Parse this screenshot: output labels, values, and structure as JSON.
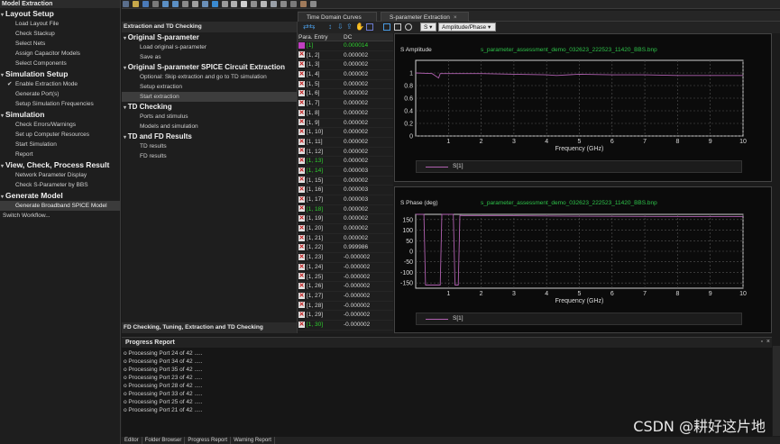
{
  "left_panel": {
    "title": "Model Extraction",
    "sections": [
      {
        "label": "Layout Setup",
        "items": [
          "Load Layout File",
          "Check Stackup",
          "Select Nets",
          "Assign Capacitor Models",
          "Select Components"
        ]
      },
      {
        "label": "Simulation Setup",
        "items": [
          "Enable Extraction Mode",
          "Generate Port(s)",
          "Setup Simulation Frequencies"
        ]
      },
      {
        "label": "Simulation",
        "items": [
          "Check Errors/Warnings",
          "Set up Computer Resources",
          "Start Simulation",
          "Report"
        ]
      },
      {
        "label": "View, Check, Process Result",
        "items": [
          "Network Parameter Display",
          "Check S-Parameter by BBS"
        ]
      },
      {
        "label": "Generate Model",
        "items": [
          "Generate Broadband SPICE Model"
        ]
      }
    ],
    "switch_workflow": "Switch Workflow..."
  },
  "mid_panel": {
    "header": "Extraction and TD Checking",
    "sections": [
      {
        "label": "Original S-parameter",
        "items": [
          "Load original s-parameter",
          "Save as"
        ]
      },
      {
        "label": "Original S-parameter SPICE Circuit Extraction",
        "items": [
          "Optional: Skip extraction and go to TD simulation",
          "Setup extraction",
          "Start extraction"
        ]
      },
      {
        "label": "TD Checking",
        "items": [
          "Ports and stimulus",
          "Models and simulation"
        ]
      },
      {
        "label": "TD and FD Results",
        "items": [
          "TD results",
          "FD results"
        ]
      }
    ],
    "footer": "FD Checking, Tuning, Extraction and TD Checking"
  },
  "table": {
    "headers": [
      "Para. Entry",
      "DC"
    ],
    "rows": [
      {
        "entry": "[1]",
        "dc": "0.000014",
        "green": true
      },
      {
        "entry": "[1, 2]",
        "dc": "0.000002",
        "green": false
      },
      {
        "entry": "[1, 3]",
        "dc": "0.000002",
        "green": false
      },
      {
        "entry": "[1, 4]",
        "dc": "0.000002",
        "green": false
      },
      {
        "entry": "[1, 5]",
        "dc": "0.000002",
        "green": false
      },
      {
        "entry": "[1, 6]",
        "dc": "0.000002",
        "green": false
      },
      {
        "entry": "[1, 7]",
        "dc": "0.000002",
        "green": false
      },
      {
        "entry": "[1, 8]",
        "dc": "0.000002",
        "green": false
      },
      {
        "entry": "[1, 9]",
        "dc": "0.000002",
        "green": false
      },
      {
        "entry": "[1, 10]",
        "dc": "0.000002",
        "green": false
      },
      {
        "entry": "[1, 11]",
        "dc": "0.000002",
        "green": false
      },
      {
        "entry": "[1, 12]",
        "dc": "0.000002",
        "green": false
      },
      {
        "entry": "[1, 13]",
        "dc": "0.000002",
        "green": true
      },
      {
        "entry": "[1, 14]",
        "dc": "0.000003",
        "green": true
      },
      {
        "entry": "[1, 15]",
        "dc": "0.000002",
        "green": false
      },
      {
        "entry": "[1, 16]",
        "dc": "0.000003",
        "green": false
      },
      {
        "entry": "[1, 17]",
        "dc": "0.000003",
        "green": false
      },
      {
        "entry": "[1, 18]",
        "dc": "0.000002",
        "green": true
      },
      {
        "entry": "[1, 19]",
        "dc": "0.000002",
        "green": false
      },
      {
        "entry": "[1, 20]",
        "dc": "0.000002",
        "green": false
      },
      {
        "entry": "[1, 21]",
        "dc": "0.000002",
        "green": false
      },
      {
        "entry": "[1, 22]",
        "dc": "0.999986",
        "green": false
      },
      {
        "entry": "[1, 23]",
        "dc": "-0.000002",
        "green": false
      },
      {
        "entry": "[1, 24]",
        "dc": "-0.000002",
        "green": false
      },
      {
        "entry": "[1, 25]",
        "dc": "-0.000002",
        "green": false
      },
      {
        "entry": "[1, 26]",
        "dc": "-0.000002",
        "green": false
      },
      {
        "entry": "[1, 27]",
        "dc": "-0.000002",
        "green": false
      },
      {
        "entry": "[1, 28]",
        "dc": "-0.000002",
        "green": false
      },
      {
        "entry": "[1, 29]",
        "dc": "-0.000002",
        "green": false
      },
      {
        "entry": "[1, 30]",
        "dc": "-0.000002",
        "green": true
      }
    ]
  },
  "tabs": [
    {
      "label": "Time Domain Curves",
      "active": false
    },
    {
      "label": "S-parameter Extraction",
      "active": true
    }
  ],
  "subtoolbar": {
    "param_select": "S",
    "view_select": "Amplitude/Phase"
  },
  "plots": {
    "amplitude": {
      "title": "S Amplitude",
      "file": "s_parameter_assessment_demo_032623_222523_11420_BBS.bnp",
      "legend": "S[1]"
    },
    "phase": {
      "title": "S Phase (deg)",
      "file": "s_parameter_assessment_demo_032623_222523_11420_BBS.bnp",
      "legend": "S[1]"
    }
  },
  "chart_data": [
    {
      "type": "line",
      "title": "S Amplitude",
      "xlabel": "Frequency (GHz)",
      "ylabel": "",
      "xlim": [
        0,
        10
      ],
      "ylim": [
        0,
        1.2
      ],
      "xticks": [
        1,
        2,
        3,
        4,
        5,
        6,
        7,
        8,
        9,
        10
      ],
      "yticks": [
        0,
        0.2,
        0.4,
        0.6,
        0.8,
        1
      ],
      "series": [
        {
          "name": "S[1]",
          "x": [
            0,
            0.5,
            0.7,
            0.75,
            1.3,
            2,
            3,
            4,
            4.3,
            5,
            6,
            7,
            8,
            9,
            10
          ],
          "y": [
            1,
            0.99,
            0.92,
            0.99,
            0.99,
            0.99,
            0.98,
            0.97,
            0.96,
            0.98,
            0.97,
            0.97,
            0.96,
            0.96,
            0.96
          ]
        }
      ],
      "grid": true
    },
    {
      "type": "line",
      "title": "S Phase (deg)",
      "xlabel": "Frequency (GHz)",
      "ylabel": "",
      "xlim": [
        0,
        10
      ],
      "ylim": [
        -175,
        175
      ],
      "xticks": [
        1,
        2,
        3,
        4,
        5,
        6,
        7,
        8,
        9,
        10
      ],
      "yticks": [
        150,
        100,
        50,
        0,
        -50,
        -100,
        -150
      ],
      "series": [
        {
          "name": "S[1]",
          "x": [
            0,
            0.25,
            0.3,
            0.75,
            0.8,
            1.15,
            1.2,
            1.3,
            1.35,
            1.5,
            3,
            5,
            7,
            10
          ],
          "y": [
            180,
            180,
            -160,
            -160,
            175,
            175,
            -160,
            -160,
            170,
            168,
            168,
            166,
            165,
            164
          ]
        }
      ],
      "grid": true
    }
  ],
  "progress": {
    "title": "Progress Report",
    "lines": [
      "o Processing Port 24 of 42 .....",
      "o Processing Port 34 of 42 .....",
      "o Processing Port 35 of 42 .....",
      "o Processing Port 23 of 42 .....",
      "o Processing Port 28 of 42 .....",
      "o Processing Port 33 of 42 .....",
      "o Processing Port 25 of 42 .....",
      "o Processing Port 21 of 42 ....."
    ]
  },
  "bottom_tabs": [
    "Editor",
    "Folder Browser",
    "Progress Report",
    "Warning Report"
  ],
  "watermark": "CSDN @耕好这片地"
}
